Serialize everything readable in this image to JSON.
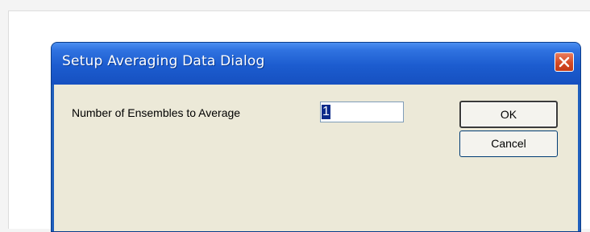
{
  "dialog": {
    "title": "Setup Averaging Data Dialog",
    "close_icon": "close-icon",
    "field_label": "Number of Ensembles to Average",
    "field_value": "1",
    "ok_label": "OK",
    "cancel_label": "Cancel"
  },
  "colors": {
    "titlebar": "#1f5fbd",
    "client": "#ece9d8",
    "close_button": "#d54a25"
  }
}
